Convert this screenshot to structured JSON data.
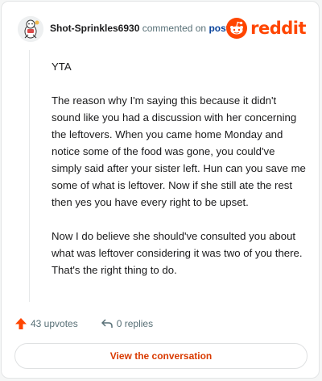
{
  "header": {
    "username": "Shot-Sprinkles6930",
    "action_text": "commented on",
    "post_link": "post",
    "brand": "reddit",
    "brand_color": "#ff4500"
  },
  "comment": {
    "paragraphs": [
      "YTA",
      "The reason why I'm saying this because it didn't sound like you had a discussion with her concerning the leftovers. When you came home Monday and notice some of the food was gone, you could've simply said after your sister left. Hun can you save me some of what is leftover. Now if she still ate the rest then yes you have every right to be upset.",
      "Now I do believe she should've consulted you about what was leftover considering it was two of you there. That's the right thing to do."
    ]
  },
  "actions": {
    "upvotes": "43 upvotes",
    "replies": "0 replies",
    "upvote_icon": "upvote-arrow-icon",
    "reply_icon": "reply-arrow-icon"
  },
  "cta": {
    "label": "View the conversation"
  }
}
